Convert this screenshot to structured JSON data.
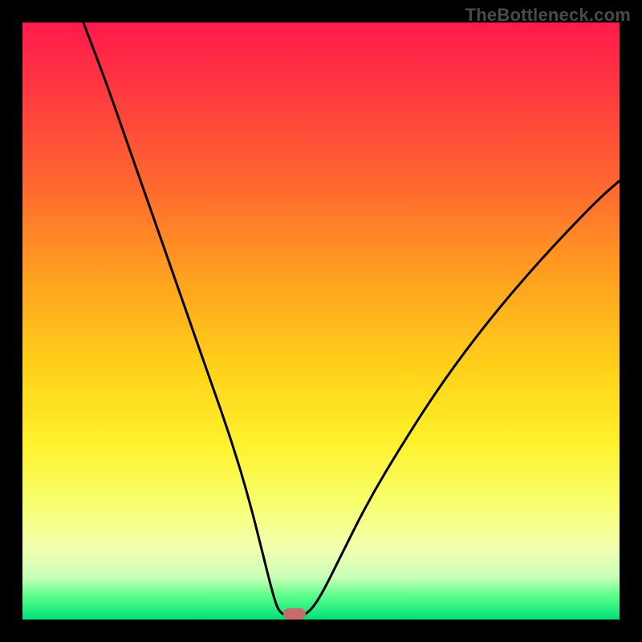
{
  "watermark": "TheBottleneck.com",
  "colors": {
    "frame": "#000000",
    "curve": "#000000",
    "marker": "#c96b6b",
    "gradient_stops": [
      "#ff1a4d",
      "#ff3b3f",
      "#ff6a2f",
      "#ff9e1f",
      "#ffd21a",
      "#fff02a",
      "#f8ff6a",
      "#f2ffb0",
      "#c8ffb8",
      "#5cff8a",
      "#00e07a"
    ]
  },
  "chart_data": {
    "type": "line",
    "title": "",
    "xlabel": "",
    "ylabel": "",
    "xlim": [
      0,
      100
    ],
    "ylim": [
      0,
      100
    ],
    "grid": false,
    "legend": false,
    "note": "Axes unlabeled; values are percentages of plot width/height. y measured from bottom (0) to top (100). Curve forms a V shape with minimum near the marker.",
    "curve_points": [
      {
        "x": 10.2,
        "y": 100.0
      },
      {
        "x": 14.0,
        "y": 90.0
      },
      {
        "x": 17.5,
        "y": 80.0
      },
      {
        "x": 21.0,
        "y": 70.0
      },
      {
        "x": 24.5,
        "y": 60.0
      },
      {
        "x": 28.0,
        "y": 50.0
      },
      {
        "x": 31.5,
        "y": 40.0
      },
      {
        "x": 35.0,
        "y": 30.0
      },
      {
        "x": 38.0,
        "y": 20.0
      },
      {
        "x": 40.5,
        "y": 10.0
      },
      {
        "x": 42.0,
        "y": 4.0
      },
      {
        "x": 43.0,
        "y": 1.2
      },
      {
        "x": 44.5,
        "y": 0.6
      },
      {
        "x": 46.5,
        "y": 0.6
      },
      {
        "x": 48.0,
        "y": 1.2
      },
      {
        "x": 50.0,
        "y": 4.0
      },
      {
        "x": 53.0,
        "y": 10.0
      },
      {
        "x": 58.0,
        "y": 20.0
      },
      {
        "x": 64.0,
        "y": 30.0
      },
      {
        "x": 70.5,
        "y": 40.0
      },
      {
        "x": 78.0,
        "y": 50.0
      },
      {
        "x": 86.5,
        "y": 60.0
      },
      {
        "x": 96.0,
        "y": 70.0
      },
      {
        "x": 100.0,
        "y": 73.5
      }
    ],
    "marker": {
      "x": 45.5,
      "y": 0.9
    }
  }
}
